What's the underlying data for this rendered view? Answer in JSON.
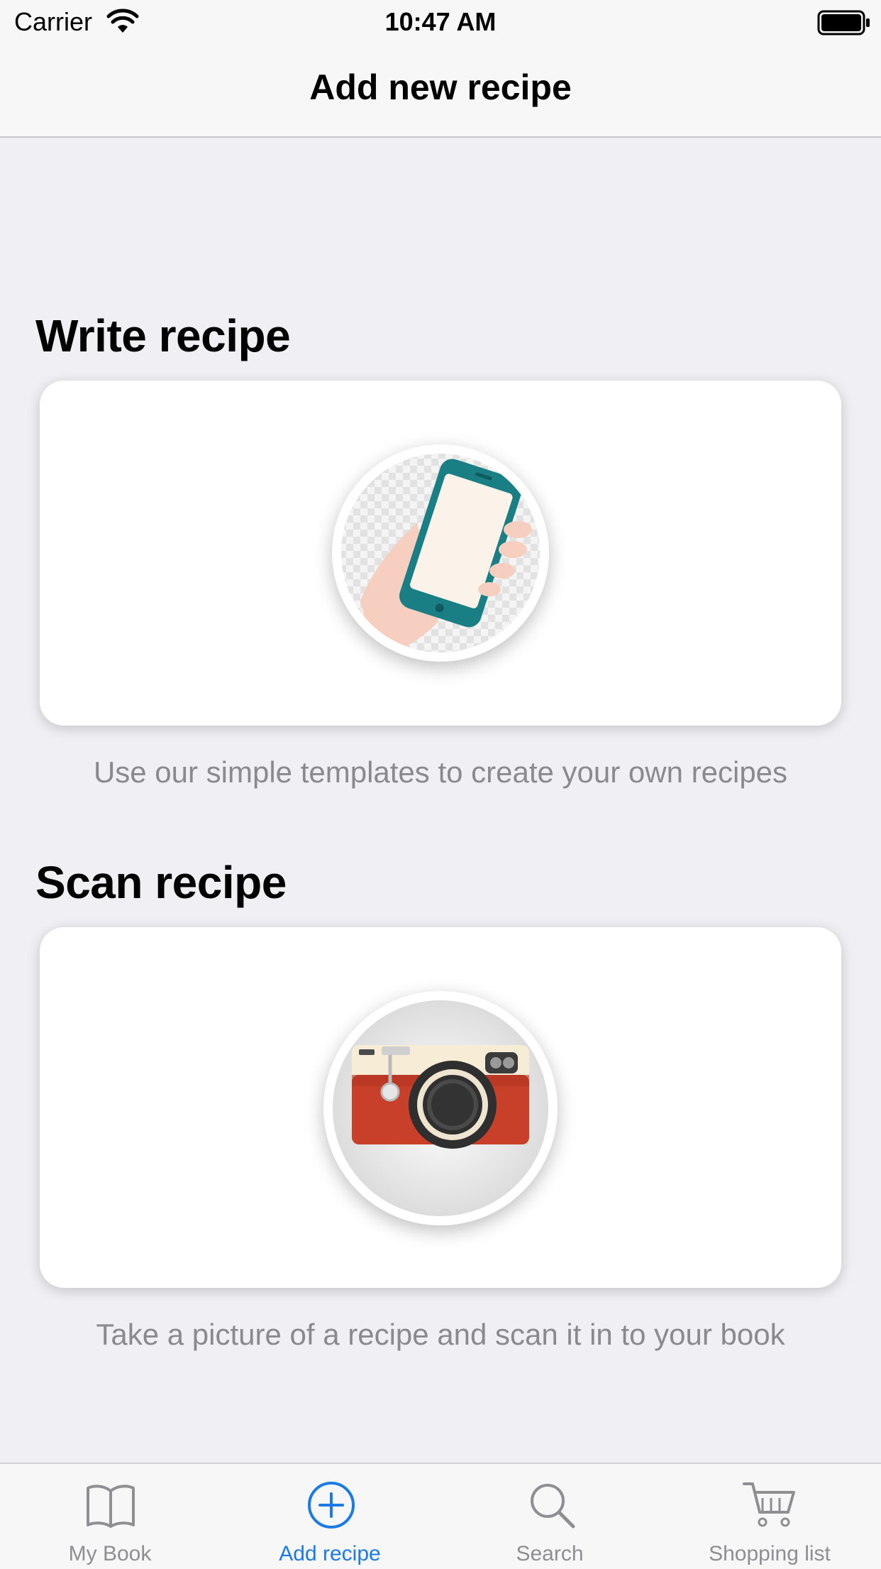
{
  "status_bar": {
    "carrier": "Carrier",
    "time": "10:47 AM"
  },
  "nav": {
    "title": "Add new recipe"
  },
  "sections": {
    "write": {
      "title": "Write recipe",
      "caption": "Use our simple templates to create your own recipes",
      "image_icon": "phone-in-hand-icon"
    },
    "scan": {
      "title": "Scan recipe",
      "caption": "Take a picture of a recipe and scan it in to your book",
      "image_icon": "camera-icon"
    }
  },
  "tab_bar": {
    "active_color": "#1a7ae6",
    "inactive_color": "#8e8e93",
    "tabs": [
      {
        "label": "My Book",
        "icon": "book-icon"
      },
      {
        "label": "Add recipe",
        "icon": "plus-circle-icon",
        "active": true
      },
      {
        "label": "Search",
        "icon": "search-icon"
      },
      {
        "label": "Shopping list",
        "icon": "cart-icon"
      }
    ]
  }
}
